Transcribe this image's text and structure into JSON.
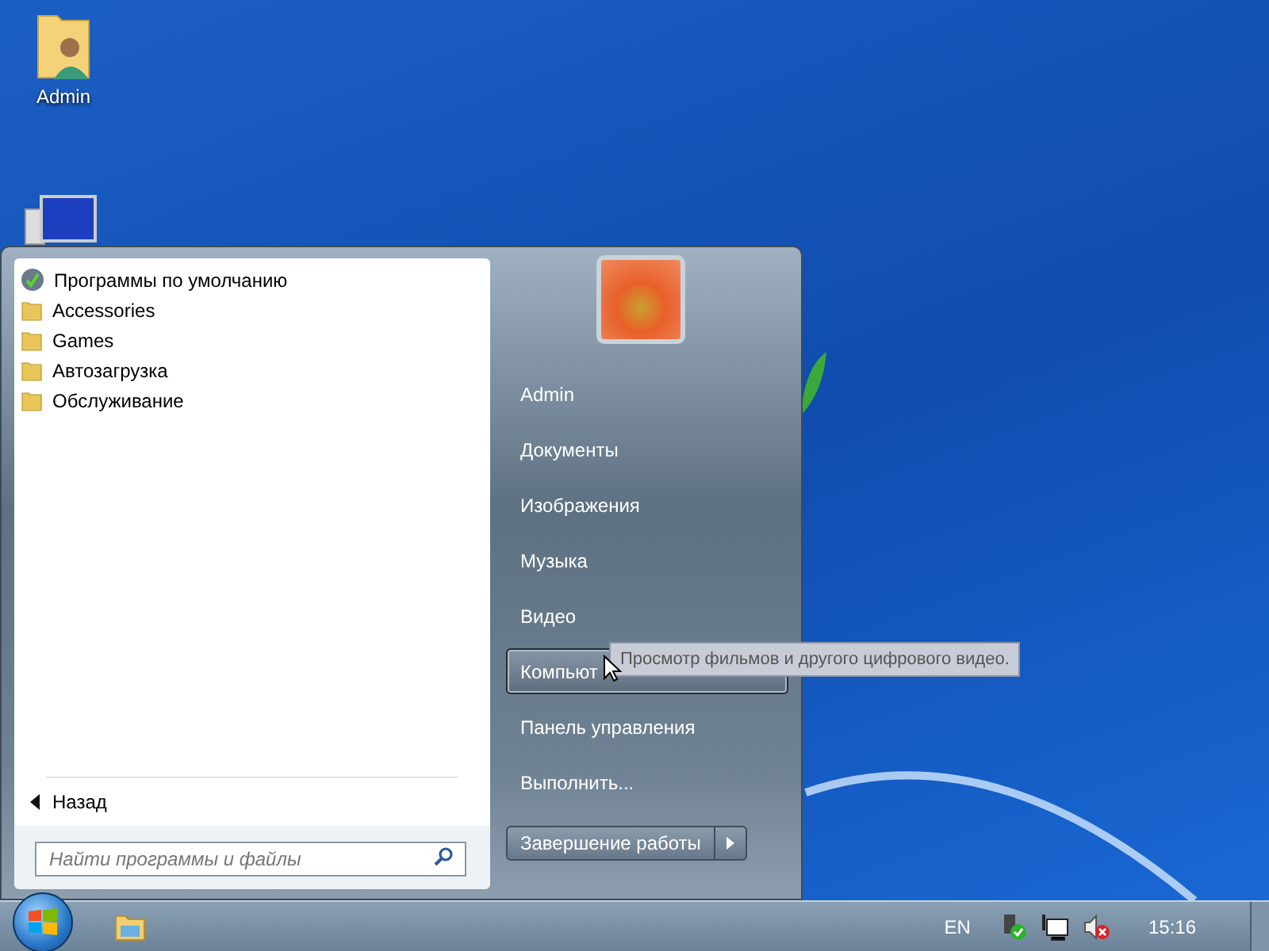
{
  "desktop_icons": [
    {
      "label": "Admin",
      "kind": "user-folder"
    },
    {
      "kind": "computer"
    }
  ],
  "start_menu": {
    "programs": [
      {
        "label": "Программы по умолчанию",
        "kind": "app"
      },
      {
        "label": "Accessories",
        "kind": "folder"
      },
      {
        "label": "Games",
        "kind": "folder"
      },
      {
        "label": "Автозагрузка",
        "kind": "folder"
      },
      {
        "label": "Обслуживание",
        "kind": "folder"
      }
    ],
    "back": "Назад",
    "search": {
      "placeholder": "Найти программы и файлы"
    },
    "places": [
      {
        "label": "Admin",
        "selected": false
      },
      {
        "label": "Документы",
        "selected": false
      },
      {
        "label": "Изображения",
        "selected": false
      },
      {
        "label": "Музыка",
        "selected": false
      },
      {
        "label": "Видео",
        "selected": false
      },
      {
        "label": "Компьют",
        "selected": true
      },
      {
        "label": "Панель управления",
        "selected": false
      },
      {
        "label": "Выполнить...",
        "selected": false
      }
    ],
    "shutdown": "Завершение работы"
  },
  "tooltip": "Просмотр фильмов и другого цифрового видео.",
  "taskbar": {
    "language": "EN",
    "clock": "15:16"
  }
}
